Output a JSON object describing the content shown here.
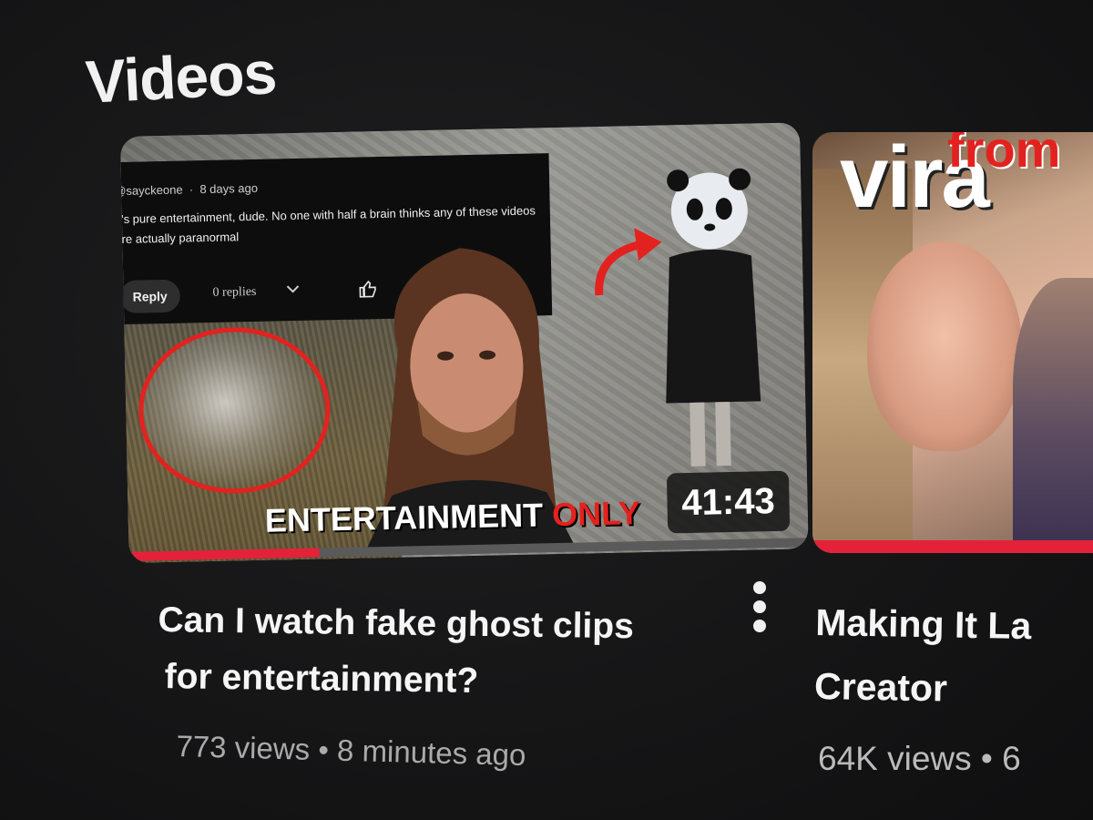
{
  "section": {
    "title": "Videos"
  },
  "videos": [
    {
      "thumbnail": {
        "comment": {
          "author": "@sayckeone",
          "age": "8 days ago",
          "text": "It's pure entertainment, dude. No one with half a brain thinks any of these videos are actually paranormal",
          "reply_label": "Reply",
          "replies_label": "0 replies"
        },
        "overlay_text_white": "ENTERTAINMENT ",
        "overlay_text_red": "ONLY"
      },
      "duration": "41:43",
      "watch_progress": 0.28,
      "title_line1": "Can I watch fake ghost clips",
      "title_line2": "for entertainment?",
      "views": "773 views",
      "separator": "•",
      "age": "8 minutes ago"
    },
    {
      "thumbnail": {
        "overlay_text_white": "vira",
        "overlay_text_red": "from"
      },
      "title_line1": "Making It La",
      "title_line2": "Creator",
      "views": "64K views",
      "separator": "•",
      "age": "6"
    }
  ],
  "colors": {
    "accent_red": "#e3223a",
    "background": "#161617",
    "meta_text": "#aaaaaa"
  },
  "icons": [
    "thumbs-up-icon",
    "chevron-down-icon",
    "more-vert-icon",
    "curved-arrow-icon"
  ]
}
